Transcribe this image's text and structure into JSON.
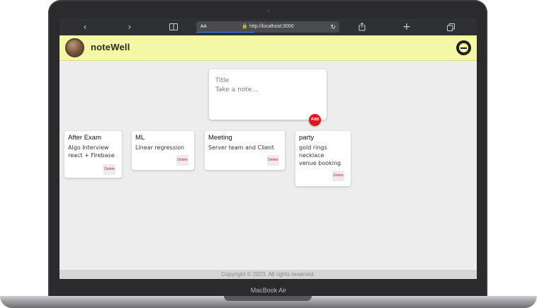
{
  "device": {
    "label": "MacBook Air"
  },
  "browser": {
    "back_icon": "‹",
    "forward_icon": "›",
    "reader_icon": "📖",
    "aa_label": "AA",
    "url": "http://localhost:3000",
    "lock_icon": "🔒",
    "reload_icon": "↻",
    "share_icon": "⇪",
    "new_tab_icon": "+",
    "tabs_icon": "⧉"
  },
  "header": {
    "brand": "noteWell",
    "theme_icon": "half-moon-toggle"
  },
  "composer": {
    "title_placeholder": "Title",
    "content_placeholder": "Take a note...",
    "add_label": "Add"
  },
  "notes": [
    {
      "title": "After Exam",
      "content": "Algo Interview\nreact + Firebase",
      "delete_label": "Delete"
    },
    {
      "title": "ML",
      "content": "Linear regression",
      "delete_label": "Delete"
    },
    {
      "title": "Meeting",
      "content": "Server team and Client",
      "delete_label": "Delete"
    },
    {
      "title": "party",
      "content": "gold rings\nnecklace\nvenue booking",
      "delete_label": "Delete"
    }
  ],
  "footer": {
    "text": "Copyright © 2023. All rights reserved."
  },
  "colors": {
    "header_bg": "#f4f7a4",
    "accent_red": "#e3141b",
    "page_bg": "#ededed",
    "browser_bar": "#2f3033"
  }
}
